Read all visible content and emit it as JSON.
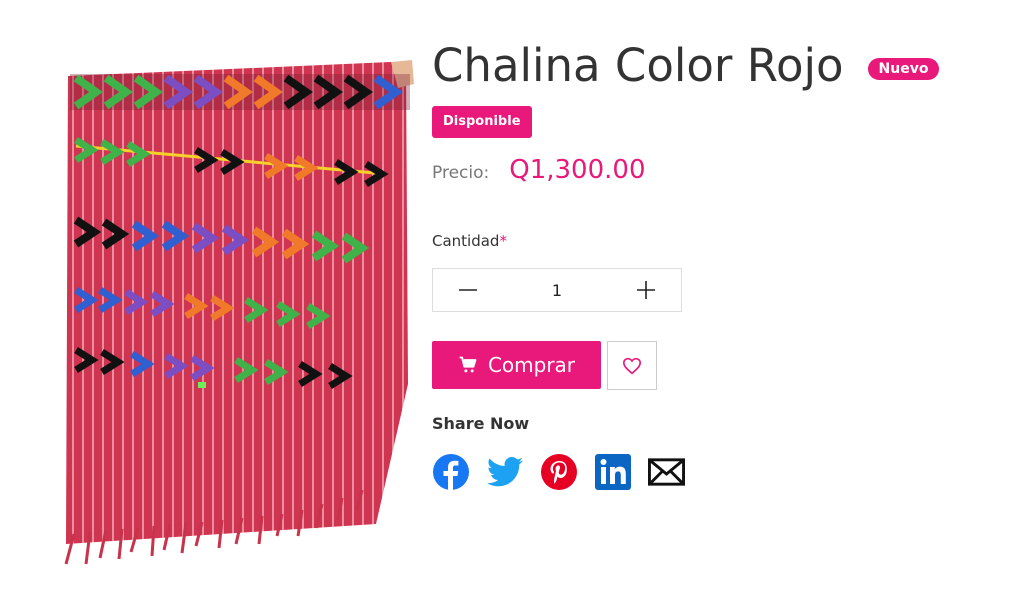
{
  "product": {
    "title": "Chalina Color Rojo",
    "badge_new": "Nuevo",
    "badge_available": "Disponible",
    "price_label": "Precio:",
    "price_value": "Q1,300.00",
    "image_icon": "woven-scarf-image"
  },
  "quantity": {
    "label": "Cantidad",
    "required_mark": "*",
    "value": "1"
  },
  "actions": {
    "buy_label": "Comprar",
    "buy_icon": "cart-icon",
    "wishlist_icon": "heart-icon"
  },
  "share": {
    "label": "Share Now",
    "networks": [
      "facebook",
      "twitter",
      "pinterest",
      "linkedin",
      "email"
    ]
  },
  "colors": {
    "accent": "#e8197b",
    "facebook": "#1877f2",
    "twitter": "#1da1f2",
    "pinterest": "#e60023",
    "linkedin": "#0a66c2",
    "scarf_red": "#d0344e"
  }
}
